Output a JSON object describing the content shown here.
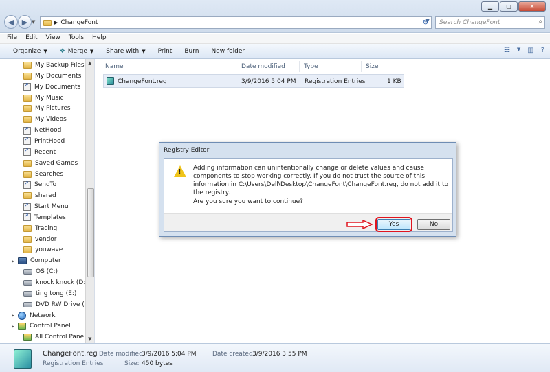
{
  "window": {
    "address_segment": "ChangeFont",
    "search_placeholder": "Search ChangeFont"
  },
  "menu": [
    "File",
    "Edit",
    "View",
    "Tools",
    "Help"
  ],
  "toolbar": {
    "organize": "Organize",
    "merge": "Merge",
    "share_with": "Share with",
    "print": "Print",
    "burn": "Burn",
    "new_folder": "New folder"
  },
  "sidebar": {
    "items": [
      {
        "label": "My Backup Files",
        "icon": "folder-icon"
      },
      {
        "label": "My Documents",
        "icon": "folder-icon"
      },
      {
        "label": "My Documents",
        "icon": "shortcut-icon"
      },
      {
        "label": "My Music",
        "icon": "folder-icon"
      },
      {
        "label": "My Pictures",
        "icon": "folder-icon"
      },
      {
        "label": "My Videos",
        "icon": "folder-icon"
      },
      {
        "label": "NetHood",
        "icon": "shortcut-icon"
      },
      {
        "label": "PrintHood",
        "icon": "shortcut-icon"
      },
      {
        "label": "Recent",
        "icon": "shortcut-icon"
      },
      {
        "label": "Saved Games",
        "icon": "folder-icon"
      },
      {
        "label": "Searches",
        "icon": "folder-icon"
      },
      {
        "label": "SendTo",
        "icon": "shortcut-icon"
      },
      {
        "label": "shared",
        "icon": "folder-icon"
      },
      {
        "label": "Start Menu",
        "icon": "shortcut-icon"
      },
      {
        "label": "Templates",
        "icon": "shortcut-icon"
      },
      {
        "label": "Tracing",
        "icon": "folder-icon"
      },
      {
        "label": "vendor",
        "icon": "folder-icon"
      },
      {
        "label": "youwave",
        "icon": "folder-icon"
      },
      {
        "label": "Computer",
        "icon": "computer-icon"
      },
      {
        "label": "OS (C:)",
        "icon": "drive-icon"
      },
      {
        "label": "knock knock (D:)",
        "icon": "drive-icon"
      },
      {
        "label": "ting tong (E:)",
        "icon": "drive-icon"
      },
      {
        "label": "DVD RW Drive (G:)",
        "icon": "drive-icon"
      },
      {
        "label": "Network",
        "icon": "network-icon"
      },
      {
        "label": "Control Panel",
        "icon": "control-panel-icon"
      },
      {
        "label": "All Control Panel It",
        "icon": "control-panel-icon"
      }
    ]
  },
  "columns": {
    "name": "Name",
    "date_modified": "Date modified",
    "type": "Type",
    "size": "Size"
  },
  "file": {
    "name": "ChangeFont.reg",
    "date_modified": "3/9/2016 5:04 PM",
    "type": "Registration Entries",
    "size": "1 KB"
  },
  "dialog": {
    "title": "Registry Editor",
    "message": "Adding information can unintentionally change or delete values and cause components to stop working correctly. If you do not trust the source of this information in C:\\Users\\Dell\\Desktop\\ChangeFont\\ChangeFont.reg, do not add it to the registry.",
    "question": "Are you sure you want to continue?",
    "yes": "Yes",
    "no": "No"
  },
  "details": {
    "filename": "ChangeFont.reg",
    "filetype": "Registration Entries",
    "date_modified_label": "Date modified:",
    "date_modified": "3/9/2016 5:04 PM",
    "size_label": "Size:",
    "size": "450 bytes",
    "date_created_label": "Date created:",
    "date_created": "3/9/2016 3:55 PM"
  }
}
